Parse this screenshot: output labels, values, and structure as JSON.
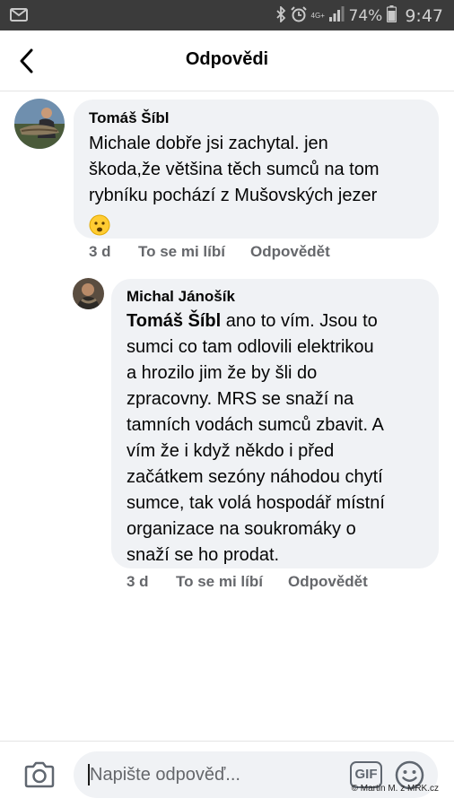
{
  "status_bar": {
    "battery_percent": "74%",
    "time": "9:47",
    "network": "4G+",
    "icons": [
      "email-icon",
      "bluetooth-icon",
      "alarm-icon",
      "signal-icon",
      "battery-icon"
    ]
  },
  "header": {
    "title": "Odpovědi",
    "back_icon": "chevron-left-icon"
  },
  "comments": [
    {
      "author": "Tomáš Šíbl",
      "lines": [
        "Michale dobře jsi zachytal. jen",
        "škoda,že většina těch sumců na tom",
        "rybníku pochází z Mušovských jezer"
      ],
      "emoji": "😦",
      "time": "3 d",
      "like_label": "To se mi líbí",
      "reply_label": "Odpovědět"
    },
    {
      "author": "Michal Jánošík",
      "mention": "Tomáš Šíbl",
      "first_line_rest": " ano to vím. Jsou to",
      "lines": [
        "sumci co tam odlovili elektrikou",
        "a hrozilo jim že by šli do",
        "zpracovny. MRS se snaží na",
        "tamních vodách sumců zbavit. A",
        "vím že i když někdo i před",
        "začátkem sezóny náhodou chytí",
        "sumce, tak volá hospodář místní",
        "organizace na soukromáky o",
        "snaží se ho prodat."
      ],
      "time": "3 d",
      "like_label": "To se mi líbí",
      "reply_label": "Odpovědět"
    }
  ],
  "composer": {
    "placeholder": "Napište odpověď...",
    "gif_label": "GIF",
    "camera_icon": "camera-icon",
    "emoji_icon": "smiley-icon"
  },
  "watermark": "© Martin M. z MRK.cz"
}
